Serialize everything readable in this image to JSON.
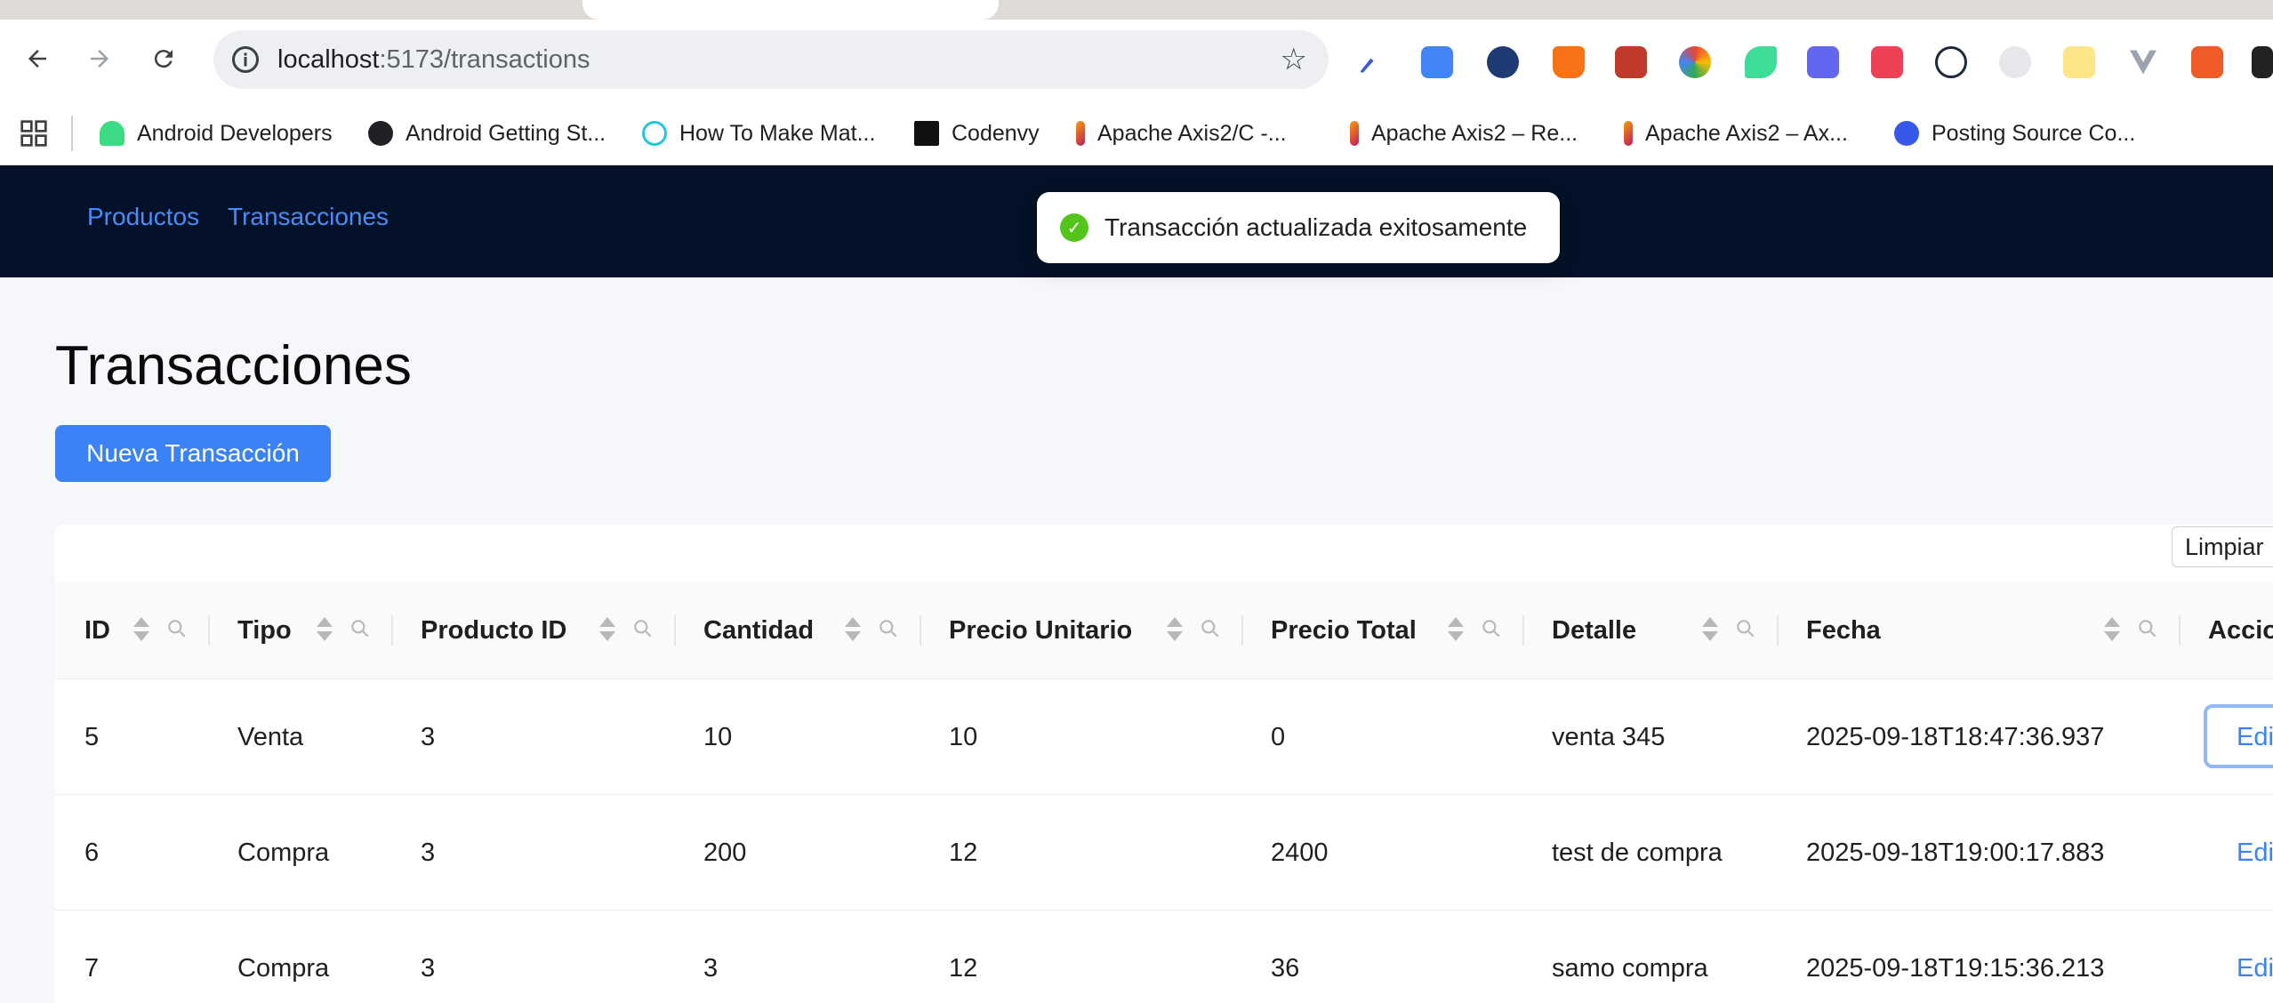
{
  "browser": {
    "url_host": "localhost",
    "url_path": ":5173/transactions",
    "bookmarks": [
      {
        "label": "Android Developers",
        "color": "#3ddc84"
      },
      {
        "label": "Android Getting St...",
        "color": "#202124"
      },
      {
        "label": "How To Make Mat...",
        "color": "#26c6da"
      },
      {
        "label": "Codenvy",
        "color": "#111111"
      },
      {
        "label": "Apache Axis2/C -...",
        "color": "#c2185b"
      },
      {
        "label": "Apache Axis2 – Re...",
        "color": "#c2185b"
      },
      {
        "label": "Apache Axis2 – Ax...",
        "color": "#c2185b"
      },
      {
        "label": "Posting Source Co...",
        "color": "#3858e9"
      }
    ]
  },
  "nav": {
    "links": [
      "Productos",
      "Transacciones"
    ],
    "link_color": "#4b8bf7",
    "bg_color": "#031228"
  },
  "toast": {
    "message": "Transacción actualizada exitosamente"
  },
  "page": {
    "title": "Transacciones",
    "new_button": "Nueva Transacción",
    "clear_button": "Limpiar"
  },
  "table": {
    "columns": [
      "ID",
      "Tipo",
      "Producto ID",
      "Cantidad",
      "Precio Unitario",
      "Precio Total",
      "Detalle",
      "Fecha",
      "Accio"
    ],
    "rows": [
      {
        "id": "5",
        "tipo": "Venta",
        "producto_id": "3",
        "cantidad": "10",
        "precio_unitario": "10",
        "precio_total": "0",
        "detalle": "venta 345",
        "fecha": "2025-09-18T18:47:36.937",
        "accion": "Edi"
      },
      {
        "id": "6",
        "tipo": "Compra",
        "producto_id": "3",
        "cantidad": "200",
        "precio_unitario": "12",
        "precio_total": "2400",
        "detalle": "test de compra",
        "fecha": "2025-09-18T19:00:17.883",
        "accion": "Edi"
      },
      {
        "id": "7",
        "tipo": "Compra",
        "producto_id": "3",
        "cantidad": "3",
        "precio_unitario": "12",
        "precio_total": "36",
        "detalle": "samo compra",
        "fecha": "2025-09-18T19:15:36.213",
        "accion": "Edi"
      }
    ]
  },
  "colors": {
    "primary": "#3b82f6",
    "success": "#52c41a"
  }
}
